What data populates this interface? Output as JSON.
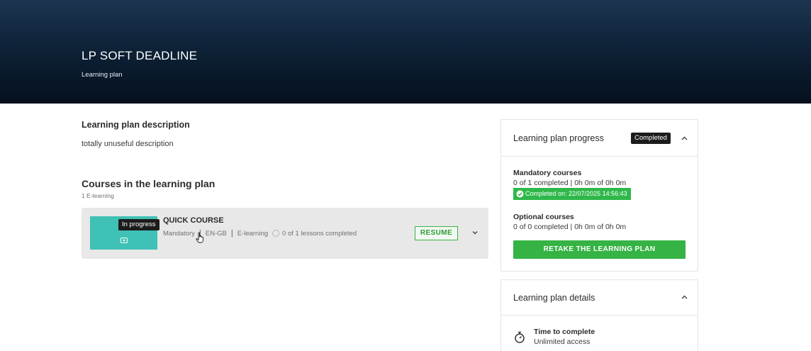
{
  "hero": {
    "title": "LP SOFT DEADLINE",
    "subtitle": "Learning plan"
  },
  "description": {
    "heading": "Learning plan description",
    "text": "totally unuseful description"
  },
  "courses": {
    "heading": "Courses in the learning plan",
    "count": "1 E-learning",
    "items": [
      {
        "status_tooltip": "In progress",
        "name": "QUICK COURSE",
        "requirement": "Mandatory",
        "language": "EN-GB",
        "type": "E-learning",
        "lessons": "0 of 1 lessons completed",
        "action_label": "RESUME",
        "thumbnail_color": "#3fc1b5"
      }
    ]
  },
  "progress_panel": {
    "title": "Learning plan progress",
    "status_badge": "Completed",
    "mandatory_heading": "Mandatory courses",
    "mandatory_text": "0 of 1 completed | 0h 0m of 0h 0m",
    "completed_on": "Completed on: 22/07/2025 14:56:43",
    "optional_heading": "Optional courses",
    "optional_text": "0 of 0 completed | 0h 0m of 0h 0m",
    "retake_label": "RETAKE THE LEARNING PLAN",
    "accent_color": "#35b344"
  },
  "details_panel": {
    "title": "Learning plan details",
    "time_label": "Time to complete",
    "time_value": "Unlimited access"
  },
  "icons": [
    "play-icon",
    "chevron-down-icon",
    "chevron-up-icon",
    "check-circle-icon",
    "timer-icon",
    "cursor-icon"
  ]
}
